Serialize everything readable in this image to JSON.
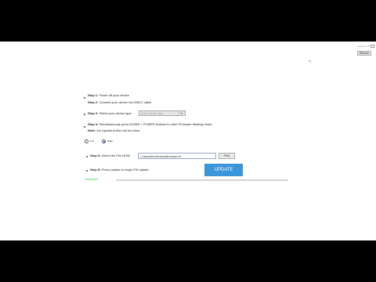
{
  "topbar": {
    "version_label": "version 2.0",
    "refresh_label": "Refresh"
  },
  "steps": {
    "step1_label": "Step 1:",
    "step1_text": "Power off your device",
    "step2_label": "Step 2:",
    "step2_text": "Connect your device via USB-C cable",
    "step3_label": "Step 3:",
    "step3_text": "Select your device type",
    "step4_label": "Step 4:",
    "step4_text": "Simultaneously press DOWN + POWER buttons to enter Firmware flashing mode",
    "note_label": "Note:",
    "note_text": "the Update button will turn blue",
    "step5a_label": "Step 5:",
    "step5a_text": "Select the FW elf file",
    "step5b_label": "Step 5:",
    "step5b_text": "Press Update to begin FW update"
  },
  "device_select": {
    "value": "Select device type"
  },
  "radios": [
    {
      "label": "Left",
      "selected": false
    },
    {
      "label": "Right",
      "selected": true
    }
  ],
  "file_input": {
    "value": "c:\\users\\dev\\Desktop\\firmware.elf"
  },
  "browse_label": "Find",
  "update_label": "UPDATE",
  "status": {
    "text": "Connected",
    "color": "#2ecc40"
  },
  "progress": {
    "fraction": 0.0
  }
}
